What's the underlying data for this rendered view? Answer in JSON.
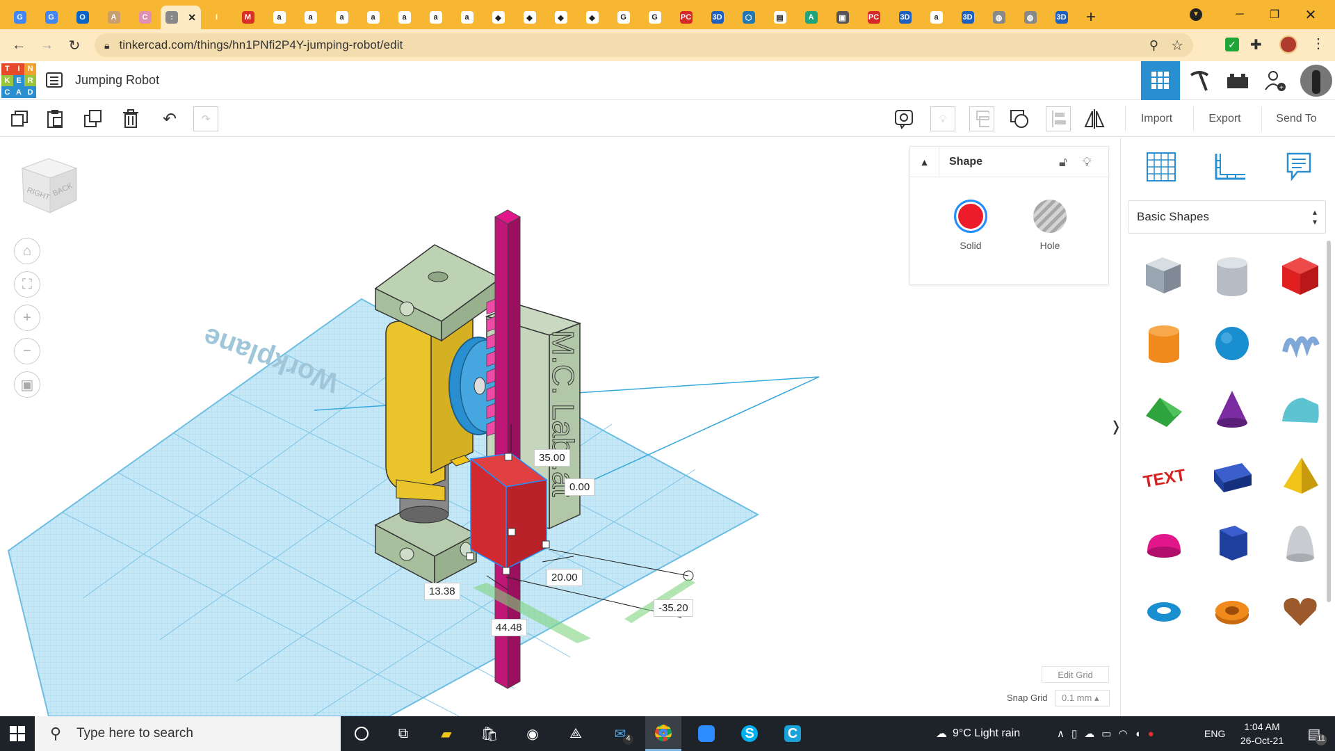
{
  "browser": {
    "tabs": [
      {
        "icon": "google-translate-icon",
        "color": "#4285f4",
        "glyph": "G"
      },
      {
        "icon": "google-translate-icon",
        "color": "#4285f4",
        "glyph": "G"
      },
      {
        "icon": "outlook-icon",
        "color": "#0a64c8",
        "glyph": "O"
      },
      {
        "icon": "avatar-icon",
        "color": "#c8a070",
        "glyph": "A"
      },
      {
        "icon": "cake-icon",
        "color": "#e090b0",
        "glyph": "C"
      },
      {
        "icon": "tinkercad-tab-icon",
        "color": "#888888",
        "glyph": ":",
        "active": true
      },
      {
        "icon": "instructables-icon",
        "color": "#f7b733",
        "glyph": "I"
      },
      {
        "icon": "gmail-icon",
        "color": "#d93025",
        "glyph": "M"
      },
      {
        "icon": "amazon-icon",
        "color": "#ffffff",
        "glyph": "a"
      },
      {
        "icon": "amazon-icon",
        "color": "#ffffff",
        "glyph": "a"
      },
      {
        "icon": "amazon-icon",
        "color": "#ffffff",
        "glyph": "a"
      },
      {
        "icon": "amazon-icon",
        "color": "#ffffff",
        "glyph": "a"
      },
      {
        "icon": "amazon-icon",
        "color": "#ffffff",
        "glyph": "a"
      },
      {
        "icon": "amazon-icon",
        "color": "#ffffff",
        "glyph": "a"
      },
      {
        "icon": "amazon-icon",
        "color": "#ffffff",
        "glyph": "a"
      },
      {
        "icon": "diamond-icon",
        "color": "#ffffff",
        "glyph": "◆"
      },
      {
        "icon": "diamond-icon",
        "color": "#ffffff",
        "glyph": "◆"
      },
      {
        "icon": "diamond-icon",
        "color": "#ffffff",
        "glyph": "◆"
      },
      {
        "icon": "diamond-icon",
        "color": "#ffffff",
        "glyph": "◆"
      },
      {
        "icon": "google-icon",
        "color": "#ffffff",
        "glyph": "G"
      },
      {
        "icon": "google-icon",
        "color": "#ffffff",
        "glyph": "G"
      },
      {
        "icon": "pcb-icon",
        "color": "#d62828",
        "glyph": "PC"
      },
      {
        "icon": "3d-icon",
        "color": "#1f5fbf",
        "glyph": "3D"
      },
      {
        "icon": "hex-icon",
        "color": "#1f77b4",
        "glyph": "⬡"
      },
      {
        "icon": "doc-icon",
        "color": "#ffffff",
        "glyph": "▤"
      },
      {
        "icon": "chart-icon",
        "color": "#1fa37a",
        "glyph": "A"
      },
      {
        "icon": "cube-icon",
        "color": "#555555",
        "glyph": "▣"
      },
      {
        "icon": "pcb-icon",
        "color": "#d62828",
        "glyph": "PC"
      },
      {
        "icon": "3d-icon",
        "color": "#1f5fbf",
        "glyph": "3D"
      },
      {
        "icon": "amazon-icon",
        "color": "#ffffff",
        "glyph": "a"
      },
      {
        "icon": "3d-icon",
        "color": "#1f5fbf",
        "glyph": "3D"
      },
      {
        "icon": "globe-icon",
        "color": "#888888",
        "glyph": "◍"
      },
      {
        "icon": "globe-icon",
        "color": "#888888",
        "glyph": "◍"
      },
      {
        "icon": "3d-icon",
        "color": "#1f5fbf",
        "glyph": "3D"
      }
    ],
    "url": "tinkercad.com/things/hn1PNfi2P4Y-jumping-robot/edit"
  },
  "app": {
    "logo_letters": [
      "T",
      "I",
      "N",
      "K",
      "E",
      "R",
      "C",
      "A",
      "D"
    ],
    "logo_colors": [
      "#e54b2a",
      "#e54b2a",
      "#f0a22a",
      "#9ac43c",
      "#2a8fd0",
      "#9ac43c",
      "#2a8fd0",
      "#2a8fd0",
      "#2a8fd0"
    ],
    "design_title": "Jumping Robot"
  },
  "toolbar": {
    "import_label": "Import",
    "export_label": "Export",
    "sendto_label": "Send To"
  },
  "viewcube": {
    "faces": [
      "RIGHT",
      "BACK"
    ]
  },
  "shape_panel": {
    "title": "Shape",
    "solid_label": "Solid",
    "hole_label": "Hole",
    "solid_color": "#ec1c2a"
  },
  "dimensions": {
    "height": "35.00",
    "elevation": "0.00",
    "length": "20.00",
    "width": "13.38",
    "pos_x": "-35.20",
    "pos_y": "44.48"
  },
  "workplane": {
    "engraved_text": "M.C. Lab..at",
    "label": "Workplane"
  },
  "library": {
    "category": "Basic Shapes",
    "shapes": [
      {
        "name": "box-striped",
        "color": "#9aa5b2"
      },
      {
        "name": "cylinder-striped",
        "color": "#b5bcc5"
      },
      {
        "name": "box",
        "color": "#e02020"
      },
      {
        "name": "cylinder",
        "color": "#f08a1c"
      },
      {
        "name": "sphere",
        "color": "#1a8fd0"
      },
      {
        "name": "scribble",
        "color": "#7fa8d8"
      },
      {
        "name": "roof",
        "color": "#2fa33d"
      },
      {
        "name": "cone",
        "color": "#7b2ca0"
      },
      {
        "name": "round-roof",
        "color": "#5ec3d0"
      },
      {
        "name": "text",
        "color": "#d62020"
      },
      {
        "name": "wedge",
        "color": "#1f3f9c"
      },
      {
        "name": "pyramid",
        "color": "#f0c419"
      },
      {
        "name": "half-sphere",
        "color": "#e0168a"
      },
      {
        "name": "polygon",
        "color": "#1f3f9c"
      },
      {
        "name": "paraboloid",
        "color": "#c8ccd0"
      },
      {
        "name": "torus",
        "color": "#1a8fd0"
      },
      {
        "name": "tube",
        "color": "#f08a1c"
      },
      {
        "name": "heart",
        "color": "#9c5a2c"
      }
    ]
  },
  "grid": {
    "edit_label": "Edit Grid",
    "snap_label": "Snap Grid",
    "snap_value": "0.1 mm ▴"
  },
  "taskbar": {
    "search_placeholder": "Type here to search",
    "weather": "9°C  Light rain",
    "lang": "ENG",
    "time": "1:04 AM",
    "date": "26-Oct-21",
    "mail_badge": "4",
    "notif_badge": "11"
  }
}
